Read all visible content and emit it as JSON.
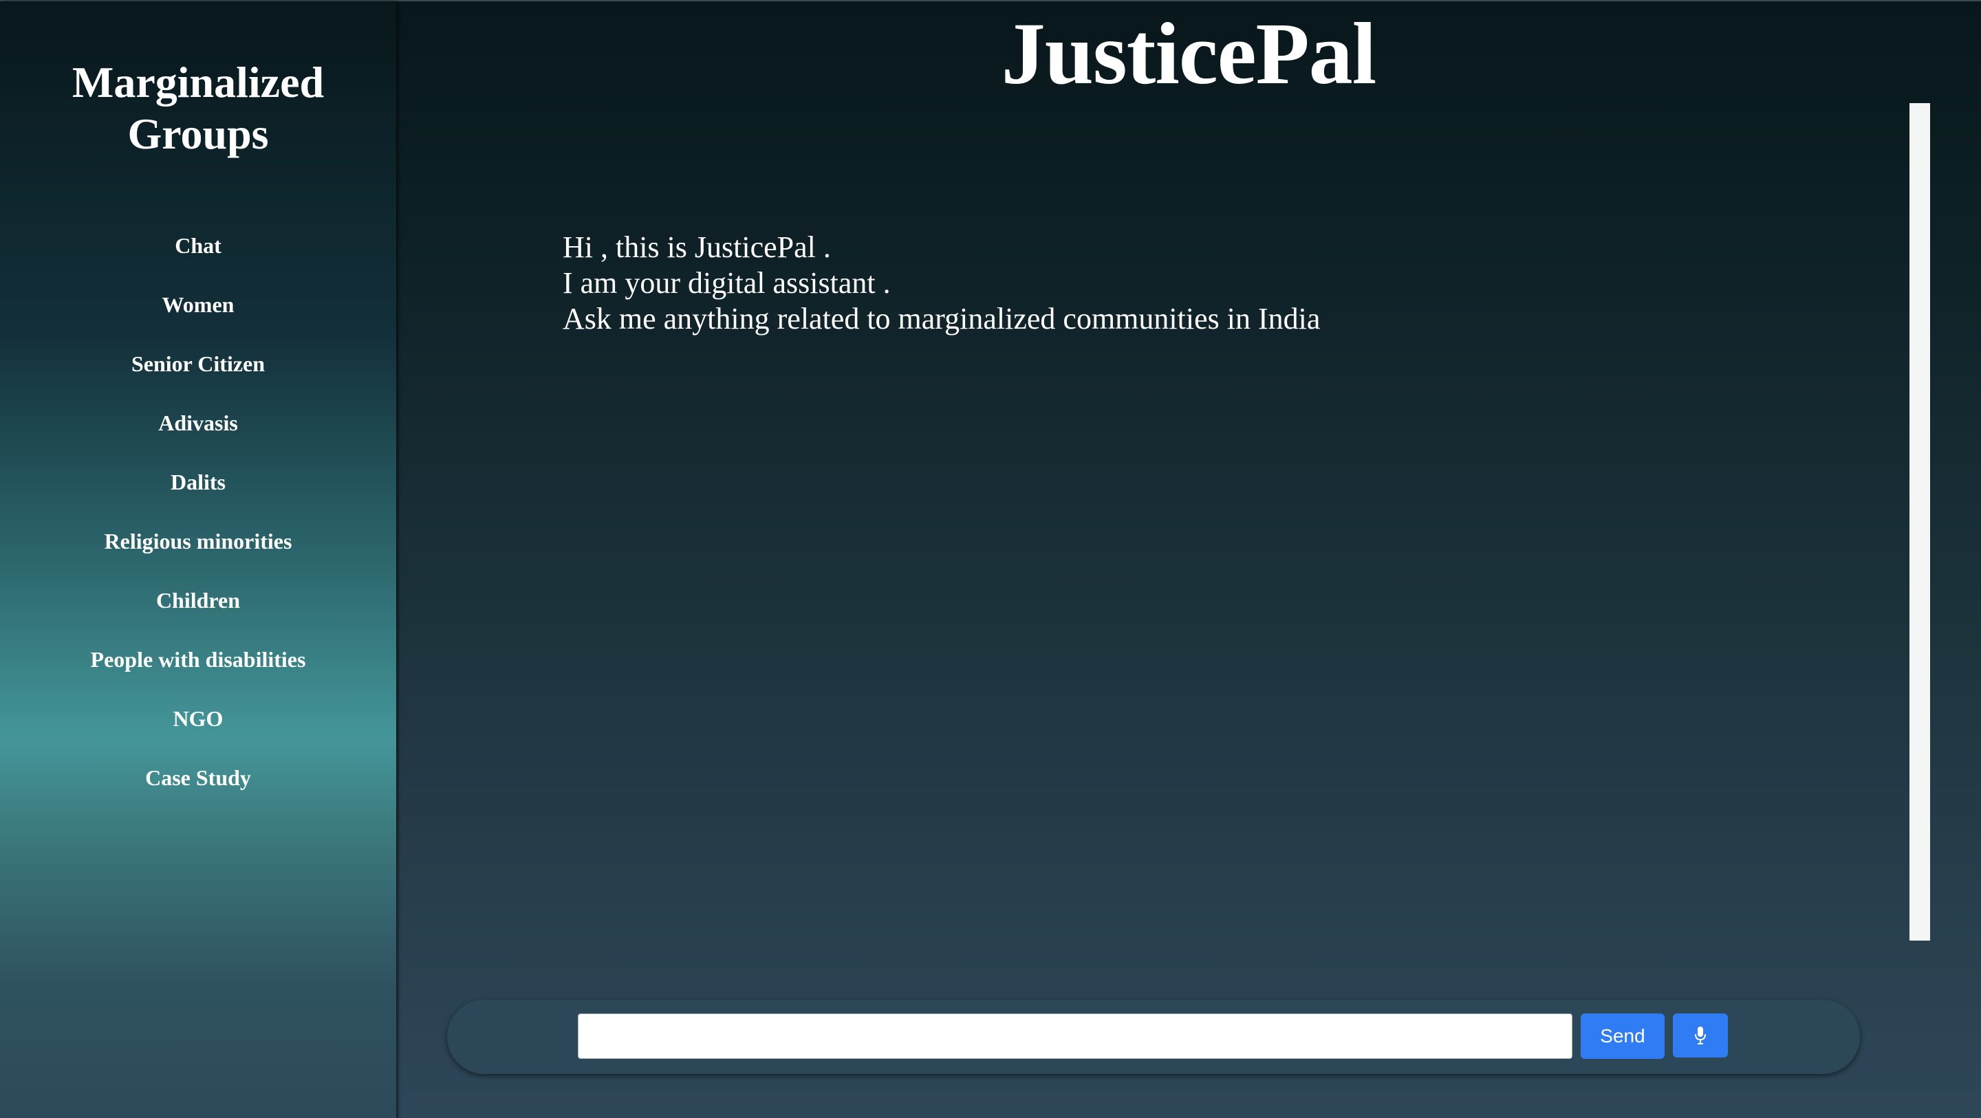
{
  "sidebar": {
    "title": "Marginalized Groups",
    "items": [
      {
        "label": "Chat"
      },
      {
        "label": "Women"
      },
      {
        "label": "Senior Citizen"
      },
      {
        "label": "Adivasis"
      },
      {
        "label": "Dalits"
      },
      {
        "label": "Religious minorities"
      },
      {
        "label": "Children"
      },
      {
        "label": "People with disabilities"
      },
      {
        "label": "NGO"
      },
      {
        "label": "Case Study"
      }
    ]
  },
  "header": {
    "title": "JusticePal"
  },
  "chat": {
    "messages": [
      "Hi , this is JusticePal .",
      "I am your digital assistant .",
      "Ask me anything related to marginalized communities in India"
    ]
  },
  "input": {
    "value": "",
    "placeholder": "",
    "send_label": "Send",
    "mic_icon": "microphone-icon"
  },
  "colors": {
    "accent": "#2f7cf5",
    "sidebar_highlight": "#449699",
    "background_dark": "#08171b"
  }
}
